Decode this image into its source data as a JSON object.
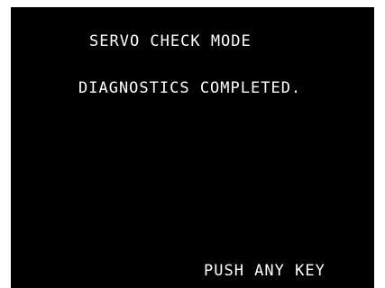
{
  "screen": {
    "background": "#000000",
    "text_color": "#ffffff",
    "title": "SERVO CHECK MODE",
    "status": "DIAGNOSTICS COMPLETED.",
    "prompt": "PUSH ANY KEY"
  }
}
